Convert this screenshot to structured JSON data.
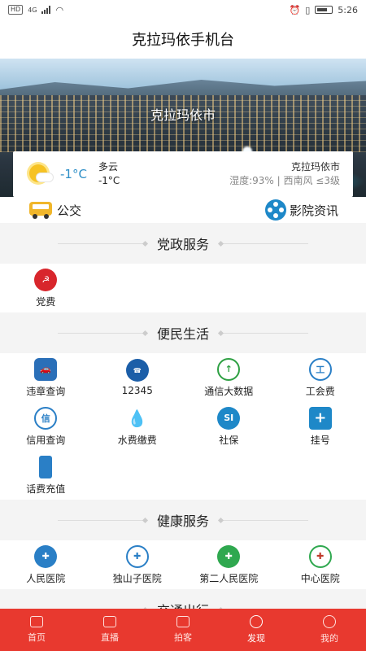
{
  "status_bar": {
    "network": "HD",
    "signal": "4G",
    "time": "5:26"
  },
  "title": "克拉玛依手机台",
  "banner": {
    "city_label": "克拉玛依市"
  },
  "weather": {
    "temp_main": "-1°C",
    "condition": "多云",
    "temp_small": "-1°C",
    "city": "克拉玛依市",
    "detail": "湿度:93% | 西南风 ≤3级"
  },
  "quick_links": [
    {
      "label": "公交",
      "icon": "bus-icon"
    },
    {
      "label": "影院资讯",
      "icon": "film-reel-icon"
    }
  ],
  "sections": {
    "party": {
      "title": "党政服务",
      "items": [
        {
          "label": "党费",
          "icon": "party-emblem-icon",
          "color": "#d8262c"
        }
      ]
    },
    "life": {
      "title": "便民生活",
      "items": [
        {
          "label": "违章查询",
          "icon": "car-violation-icon",
          "color": "#2a6fb8"
        },
        {
          "label": "12345",
          "icon": "hotline-12345-icon",
          "color": "#1b5ea8"
        },
        {
          "label": "通信大数据",
          "icon": "telecom-data-icon",
          "color": "#2ea043"
        },
        {
          "label": "工会费",
          "icon": "union-fee-icon",
          "color": "#2a7fc6"
        },
        {
          "label": "信用查询",
          "icon": "credit-icon",
          "color": "#2a7fc6"
        },
        {
          "label": "水费缴费",
          "icon": "water-drop-icon",
          "color": "#3b8fd8"
        },
        {
          "label": "社保",
          "icon": "social-security-icon",
          "color": "#1e88c8"
        },
        {
          "label": "挂号",
          "icon": "medical-cross-icon",
          "color": "#1e88c8"
        },
        {
          "label": "话费充值",
          "icon": "phone-icon",
          "color": "#2a7fc6"
        }
      ]
    },
    "health": {
      "title": "健康服务",
      "items": [
        {
          "label": "人民医院",
          "icon": "peoples-hospital-icon",
          "color": "#2a7fc6"
        },
        {
          "label": "独山子医院",
          "icon": "dushanzi-hospital-icon",
          "color": "#2a7fc6"
        },
        {
          "label": "第二人民医院",
          "icon": "second-hospital-icon",
          "color": "#2fa84f"
        },
        {
          "label": "中心医院",
          "icon": "central-hospital-icon",
          "color": "#c0392b"
        }
      ]
    },
    "transport": {
      "title": "交通出行"
    }
  },
  "tabs": [
    {
      "label": "首页",
      "icon": "home-icon"
    },
    {
      "label": "直播",
      "icon": "tv-icon"
    },
    {
      "label": "拍客",
      "icon": "camera-icon"
    },
    {
      "label": "发现",
      "icon": "compass-icon",
      "active": true
    },
    {
      "label": "我的",
      "icon": "user-icon"
    }
  ],
  "colors": {
    "accent": "#e8392f",
    "temp": "#2e8fc7"
  }
}
